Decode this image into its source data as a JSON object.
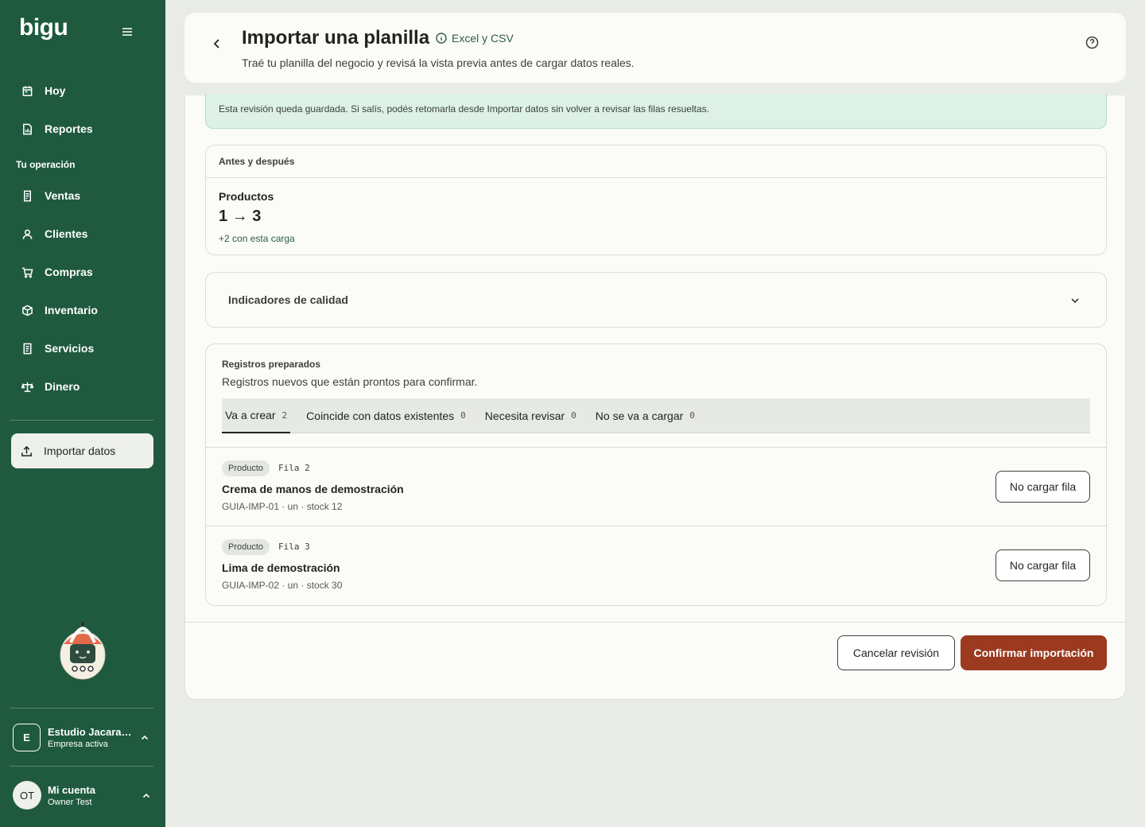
{
  "app": {
    "logo": "bigu"
  },
  "sidebar": {
    "top_items": [
      {
        "label": "Hoy",
        "icon": "calendar-icon"
      },
      {
        "label": "Reportes",
        "icon": "report-icon"
      }
    ],
    "section_label": "Tu operación",
    "items": [
      {
        "label": "Ventas",
        "icon": "receipt-icon"
      },
      {
        "label": "Clientes",
        "icon": "user-icon"
      },
      {
        "label": "Compras",
        "icon": "cart-icon"
      },
      {
        "label": "Inventario",
        "icon": "box-icon"
      },
      {
        "label": "Servicios",
        "icon": "document-icon"
      },
      {
        "label": "Dinero",
        "icon": "scale-icon"
      }
    ],
    "active_item": {
      "label": "Importar datos",
      "icon": "upload-icon"
    },
    "company": {
      "initial": "E",
      "name": "Estudio Jacaranda",
      "status": "Empresa activa"
    },
    "account": {
      "initials": "OT",
      "title": "Mi cuenta",
      "name": "Owner Test"
    }
  },
  "header": {
    "title": "Importar una planilla",
    "format_hint": "Excel y CSV",
    "subtitle": "Traé tu planilla del negocio y revisá la vista previa antes de cargar datos reales."
  },
  "notice": "Esta revisión queda guardada. Si salís, podés retomarla desde Importar datos sin volver a revisar las filas resueltas.",
  "before_after": {
    "heading": "Antes y después",
    "label": "Productos",
    "value": "1 → 3",
    "delta": "+2 con esta carga"
  },
  "quality": {
    "label": "Indicadores de calidad"
  },
  "records": {
    "title": "Registros preparados",
    "subtitle": "Registros nuevos que están prontos para confirmar.",
    "tabs": [
      {
        "label": "Va a crear",
        "count": "2"
      },
      {
        "label": "Coincide con datos existentes",
        "count": "0"
      },
      {
        "label": "Necesita revisar",
        "count": "0"
      },
      {
        "label": "No se va a cargar",
        "count": "0"
      }
    ],
    "rows": [
      {
        "badge": "Producto",
        "row": "Fila 2",
        "name": "Crema de manos de demostración",
        "meta": "GUIA-IMP-01 · un · stock 12",
        "action": "No cargar fila"
      },
      {
        "badge": "Producto",
        "row": "Fila 3",
        "name": "Lima de demostración",
        "meta": "GUIA-IMP-02 · un · stock 30",
        "action": "No cargar fila"
      }
    ]
  },
  "footer": {
    "cancel": "Cancelar revisión",
    "confirm": "Confirmar importación"
  },
  "colors": {
    "sidebar": "#1f5a3f",
    "accent_button": "#9b3a1e",
    "notice_bg": "#ddf1e7"
  }
}
